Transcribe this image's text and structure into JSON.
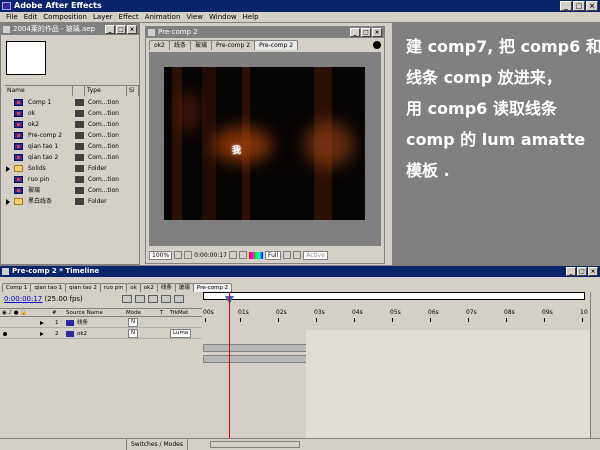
{
  "app": {
    "title": "Adobe After Effects"
  },
  "menu": [
    "File",
    "Edit",
    "Composition",
    "Layer",
    "Effect",
    "Animation",
    "View",
    "Window",
    "Help"
  ],
  "project": {
    "title": "2004莱的作品 - 玻璃.aep",
    "columns": [
      "Name",
      "Type",
      "Si"
    ],
    "items": [
      {
        "name": "Comp 1",
        "type": "Com...tion",
        "kind": "comp"
      },
      {
        "name": "ok",
        "type": "Com...tion",
        "kind": "comp"
      },
      {
        "name": "ok2",
        "type": "Com...tion",
        "kind": "comp"
      },
      {
        "name": "Pre-comp 2",
        "type": "Com...tion",
        "kind": "comp"
      },
      {
        "name": "qian tao 1",
        "type": "Com...tion",
        "kind": "comp"
      },
      {
        "name": "qian tao 2",
        "type": "Com...tion",
        "kind": "comp"
      },
      {
        "name": "Solids",
        "type": "Folder",
        "kind": "folder"
      },
      {
        "name": "ruo pin",
        "type": "Com...tion",
        "kind": "comp"
      },
      {
        "name": "玻璃",
        "type": "Com...tion",
        "kind": "comp"
      },
      {
        "name": "黑白线条",
        "type": "Folder",
        "kind": "folder"
      }
    ]
  },
  "viewer": {
    "title": "Pre-comp 2",
    "tabs": [
      "ok2",
      "线条",
      "玻璃",
      "Pre-comp 2",
      "Pre-comp 2"
    ],
    "canvas_text": "我",
    "zoom": "100%",
    "timecode": "0:00:00:17",
    "resolution": "Full",
    "view": "Active"
  },
  "instructions": [
    "建 comp7, 把 comp6 和",
    "线条 comp 放进来，",
    "用 comp6 读取线条",
    "comp 的 lum amatte",
    "模板 ."
  ],
  "timeline": {
    "title": "Pre-comp 2 * Timeline",
    "tabs": [
      "Comp 1",
      "qian tao 1",
      "qian tao 2",
      "ruo pin",
      "ok",
      "ok2",
      "线条",
      "玻璃",
      "Pre-comp 2"
    ],
    "timecode": "0:00:00:17",
    "fps": "(25.00 fps)",
    "columns": [
      "#",
      "Source Name",
      "Mode",
      "T",
      "TrkMat"
    ],
    "layers": [
      {
        "num": "1",
        "name": "线条",
        "mode": "N",
        "trkmat": ""
      },
      {
        "num": "2",
        "name": "ok2",
        "mode": "N",
        "trkmat": "Luma"
      }
    ],
    "ruler": [
      "00s",
      "01s",
      "02s",
      "03s",
      "04s",
      "05s",
      "06s",
      "07s",
      "08s",
      "09s",
      "10"
    ],
    "switches_label": "Switches / Modes"
  }
}
